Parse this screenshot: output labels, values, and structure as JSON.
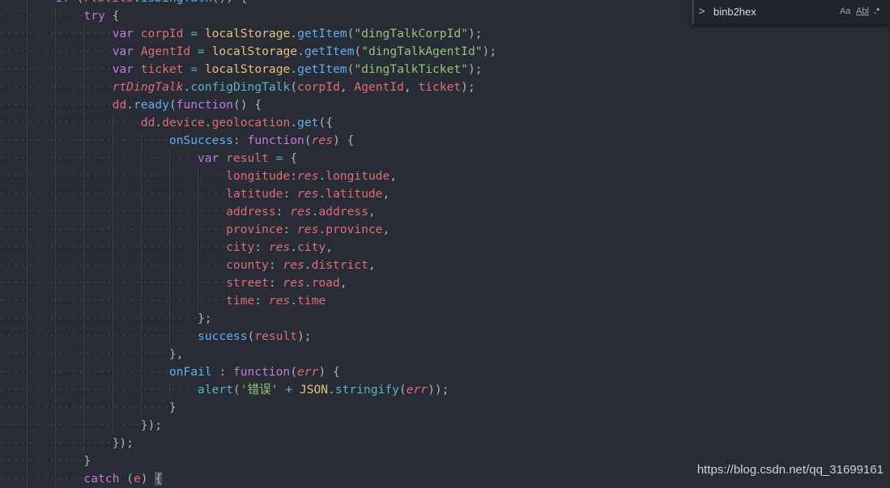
{
  "find_widget": {
    "query": "binb2hex",
    "toggle_label": ">",
    "match_case_label": "Aa",
    "whole_word_label": "Abl",
    "regex_label": ".*"
  },
  "watermark": "https://blog.csdn.net/qq_31699161",
  "colors": {
    "background": "#282c34",
    "keyword": "#c678dd",
    "variable": "#e06c75",
    "string": "#98c379",
    "function": "#61afef",
    "type": "#e5c07b"
  },
  "code_lines": [
    {
      "indent": 2,
      "tokens": [
        [
          "k",
          "if"
        ],
        [
          "p",
          " ("
        ],
        [
          "i",
          "rtUtils"
        ],
        [
          "p",
          "."
        ],
        [
          "f",
          "isDingTalk"
        ],
        [
          "p",
          "()) {"
        ]
      ]
    },
    {
      "indent": 3,
      "tokens": [
        [
          "k",
          "try"
        ],
        [
          "p",
          " {"
        ]
      ]
    },
    {
      "indent": 4,
      "tokens": [
        [
          "k",
          "var"
        ],
        [
          "p",
          " "
        ],
        [
          "v",
          "corpId"
        ],
        [
          "p",
          " "
        ],
        [
          "o",
          "="
        ],
        [
          "p",
          " "
        ],
        [
          "y",
          "localStorage"
        ],
        [
          "p",
          "."
        ],
        [
          "f",
          "getItem"
        ],
        [
          "p",
          "("
        ],
        [
          "s",
          "\"dingTalkCorpId\""
        ],
        [
          "p",
          ");"
        ]
      ]
    },
    {
      "indent": 4,
      "tokens": [
        [
          "k",
          "var"
        ],
        [
          "p",
          " "
        ],
        [
          "v",
          "AgentId"
        ],
        [
          "p",
          " "
        ],
        [
          "o",
          "="
        ],
        [
          "p",
          " "
        ],
        [
          "y",
          "localStorage"
        ],
        [
          "p",
          "."
        ],
        [
          "f",
          "getItem"
        ],
        [
          "p",
          "("
        ],
        [
          "s",
          "\"dingTalkAgentId\""
        ],
        [
          "p",
          ");"
        ]
      ]
    },
    {
      "indent": 4,
      "tokens": [
        [
          "k",
          "var"
        ],
        [
          "p",
          " "
        ],
        [
          "v",
          "ticket"
        ],
        [
          "p",
          " "
        ],
        [
          "o",
          "="
        ],
        [
          "p",
          " "
        ],
        [
          "y",
          "localStorage"
        ],
        [
          "p",
          "."
        ],
        [
          "f",
          "getItem"
        ],
        [
          "p",
          "("
        ],
        [
          "s",
          "\"dingTalkTicket\""
        ],
        [
          "p",
          ");"
        ]
      ]
    },
    {
      "indent": 4,
      "tokens": [
        [
          "i",
          "rtDingTalk"
        ],
        [
          "p",
          "."
        ],
        [
          "c",
          "configDingTalk"
        ],
        [
          "p",
          "("
        ],
        [
          "v",
          "corpId"
        ],
        [
          "p",
          ", "
        ],
        [
          "v",
          "AgentId"
        ],
        [
          "p",
          ", "
        ],
        [
          "v",
          "ticket"
        ],
        [
          "p",
          ");"
        ]
      ]
    },
    {
      "indent": 4,
      "tokens": [
        [
          "v",
          "dd"
        ],
        [
          "p",
          "."
        ],
        [
          "f",
          "ready"
        ],
        [
          "p",
          "("
        ],
        [
          "k",
          "function"
        ],
        [
          "p",
          "() {"
        ]
      ]
    },
    {
      "indent": 5,
      "tokens": [
        [
          "v",
          "dd"
        ],
        [
          "p",
          "."
        ],
        [
          "v",
          "device"
        ],
        [
          "p",
          "."
        ],
        [
          "v",
          "geolocation"
        ],
        [
          "p",
          "."
        ],
        [
          "f",
          "get"
        ],
        [
          "p",
          "({"
        ]
      ]
    },
    {
      "indent": 6,
      "tokens": [
        [
          "f",
          "onSuccess"
        ],
        [
          "p",
          ": "
        ],
        [
          "k",
          "function"
        ],
        [
          "p",
          "("
        ],
        [
          "i",
          "res"
        ],
        [
          "p",
          ") {"
        ]
      ]
    },
    {
      "indent": 7,
      "tokens": [
        [
          "k",
          "var"
        ],
        [
          "p",
          " "
        ],
        [
          "v",
          "result"
        ],
        [
          "p",
          " "
        ],
        [
          "o",
          "="
        ],
        [
          "p",
          " {"
        ]
      ]
    },
    {
      "indent": 8,
      "tokens": [
        [
          "v",
          "longitude"
        ],
        [
          "p",
          ":"
        ],
        [
          "i",
          "res"
        ],
        [
          "p",
          "."
        ],
        [
          "v",
          "longitude"
        ],
        [
          "p",
          ","
        ]
      ]
    },
    {
      "indent": 8,
      "tokens": [
        [
          "v",
          "latitude"
        ],
        [
          "p",
          ": "
        ],
        [
          "i",
          "res"
        ],
        [
          "p",
          "."
        ],
        [
          "v",
          "latitude"
        ],
        [
          "p",
          ","
        ]
      ]
    },
    {
      "indent": 8,
      "tokens": [
        [
          "v",
          "address"
        ],
        [
          "p",
          ": "
        ],
        [
          "i",
          "res"
        ],
        [
          "p",
          "."
        ],
        [
          "v",
          "address"
        ],
        [
          "p",
          ","
        ]
      ]
    },
    {
      "indent": 8,
      "tokens": [
        [
          "v",
          "province"
        ],
        [
          "p",
          ": "
        ],
        [
          "i",
          "res"
        ],
        [
          "p",
          "."
        ],
        [
          "v",
          "province"
        ],
        [
          "p",
          ","
        ]
      ]
    },
    {
      "indent": 8,
      "tokens": [
        [
          "v",
          "city"
        ],
        [
          "p",
          ": "
        ],
        [
          "i",
          "res"
        ],
        [
          "p",
          "."
        ],
        [
          "v",
          "city"
        ],
        [
          "p",
          ","
        ]
      ]
    },
    {
      "indent": 8,
      "tokens": [
        [
          "v",
          "county"
        ],
        [
          "p",
          ": "
        ],
        [
          "i",
          "res"
        ],
        [
          "p",
          "."
        ],
        [
          "v",
          "district"
        ],
        [
          "p",
          ","
        ]
      ]
    },
    {
      "indent": 8,
      "tokens": [
        [
          "v",
          "street"
        ],
        [
          "p",
          ": "
        ],
        [
          "i",
          "res"
        ],
        [
          "p",
          "."
        ],
        [
          "v",
          "road"
        ],
        [
          "p",
          ","
        ]
      ]
    },
    {
      "indent": 8,
      "tokens": [
        [
          "v",
          "time"
        ],
        [
          "p",
          ": "
        ],
        [
          "i",
          "res"
        ],
        [
          "p",
          "."
        ],
        [
          "v",
          "time"
        ]
      ]
    },
    {
      "indent": 7,
      "tokens": [
        [
          "p",
          "};"
        ]
      ]
    },
    {
      "indent": 7,
      "tokens": [
        [
          "f",
          "success"
        ],
        [
          "p",
          "("
        ],
        [
          "v",
          "result"
        ],
        [
          "p",
          ");"
        ]
      ]
    },
    {
      "indent": 6,
      "tokens": [
        [
          "p",
          "},"
        ]
      ]
    },
    {
      "indent": 6,
      "tokens": [
        [
          "f",
          "onFail"
        ],
        [
          "p",
          " : "
        ],
        [
          "k",
          "function"
        ],
        [
          "p",
          "("
        ],
        [
          "i",
          "err"
        ],
        [
          "p",
          ") {"
        ]
      ]
    },
    {
      "indent": 7,
      "tokens": [
        [
          "c",
          "alert"
        ],
        [
          "p",
          "("
        ],
        [
          "s",
          "'错误'"
        ],
        [
          "p",
          " "
        ],
        [
          "o",
          "+"
        ],
        [
          "p",
          " "
        ],
        [
          "y",
          "JSON"
        ],
        [
          "p",
          "."
        ],
        [
          "c",
          "stringify"
        ],
        [
          "p",
          "("
        ],
        [
          "i",
          "err"
        ],
        [
          "p",
          "));"
        ]
      ]
    },
    {
      "indent": 6,
      "tokens": [
        [
          "p",
          "}"
        ]
      ]
    },
    {
      "indent": 5,
      "tokens": [
        [
          "p",
          "});"
        ]
      ]
    },
    {
      "indent": 4,
      "tokens": [
        [
          "p",
          "});"
        ]
      ]
    },
    {
      "indent": 3,
      "tokens": [
        [
          "p",
          "}"
        ]
      ]
    },
    {
      "indent": 3,
      "tokens": [
        [
          "k",
          "catch"
        ],
        [
          "p",
          " ("
        ],
        [
          "v",
          "e"
        ],
        [
          "p",
          ") "
        ],
        [
          "cur",
          "{"
        ]
      ]
    }
  ]
}
